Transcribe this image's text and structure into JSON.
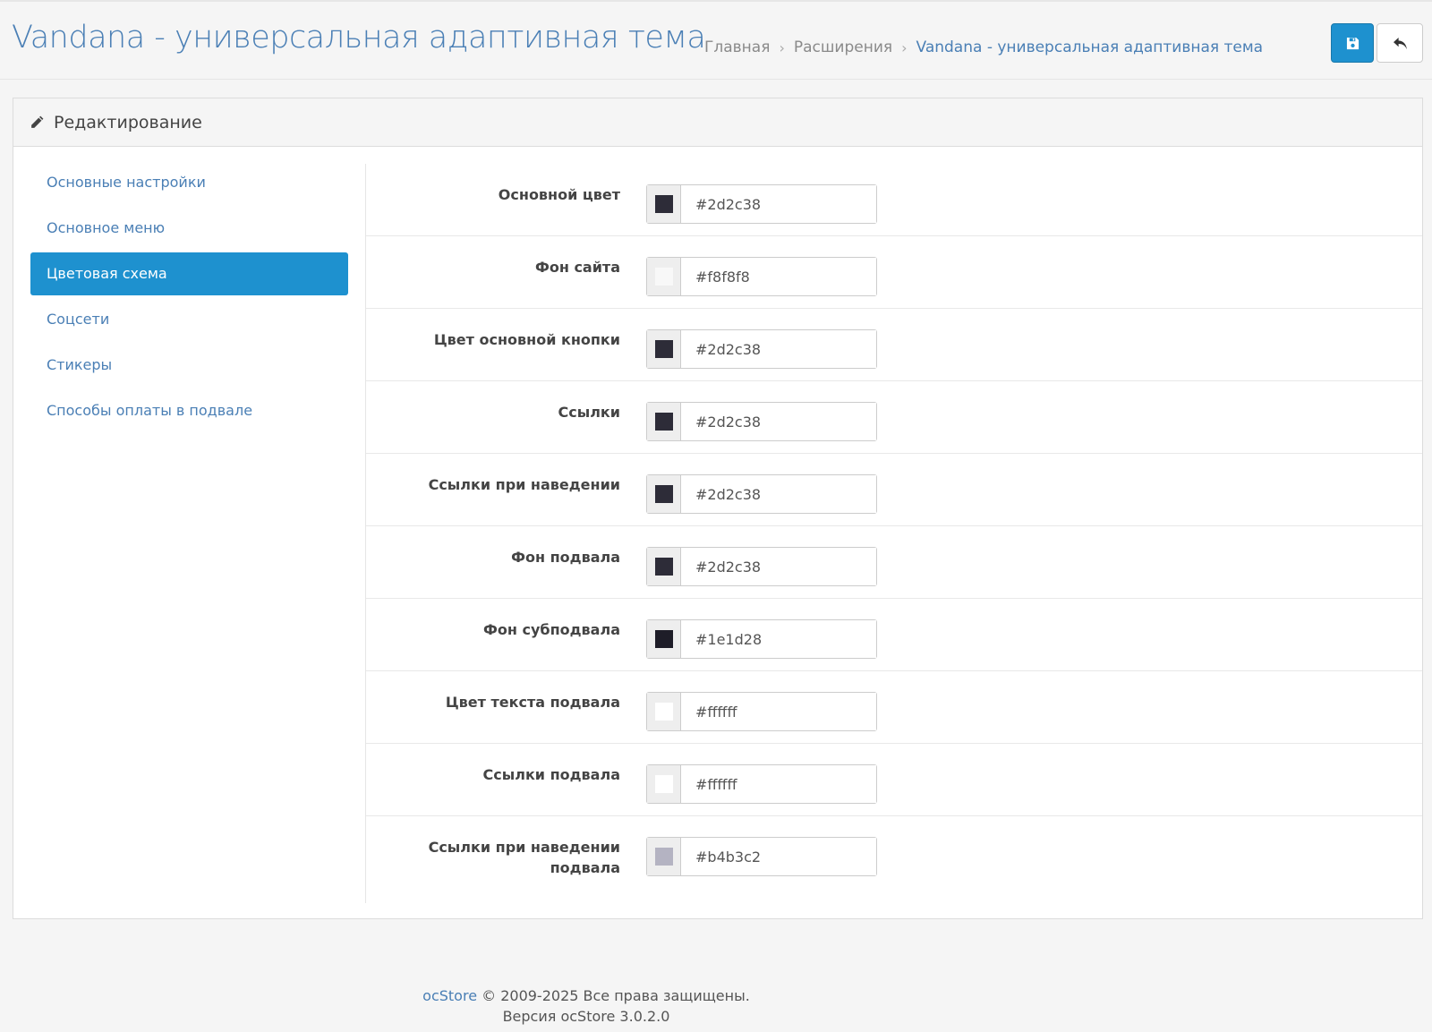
{
  "header": {
    "title": "Vandana - универсальная адаптивная тема",
    "breadcrumb": [
      "Главная",
      "Расширения",
      "Vandana - универсальная адаптивная тема"
    ],
    "save_icon": "floppy-disk-icon",
    "back_icon": "reply-icon"
  },
  "panel": {
    "icon": "pencil-icon",
    "title": "Редактирование"
  },
  "nav": {
    "items": [
      "Основные настройки",
      "Основное меню",
      "Цветовая схема",
      "Соцсети",
      "Стикеры",
      "Способы оплаты в подвале"
    ],
    "active_index": 2
  },
  "colors": [
    {
      "label": "Основной цвет",
      "value": "#2d2c38"
    },
    {
      "label": "Фон сайта",
      "value": "#f8f8f8"
    },
    {
      "label": "Цвет основной кнопки",
      "value": "#2d2c38"
    },
    {
      "label": "Ссылки",
      "value": "#2d2c38"
    },
    {
      "label": "Ссылки при наведении",
      "value": "#2d2c38"
    },
    {
      "label": "Фон подвала",
      "value": "#2d2c38"
    },
    {
      "label": "Фон субподвала",
      "value": "#1e1d28"
    },
    {
      "label": "Цвет текста подвала",
      "value": "#ffffff"
    },
    {
      "label": "Ссылки подвала",
      "value": "#ffffff"
    },
    {
      "label": "Ссылки при наведении подвала",
      "value": "#b4b3c2"
    }
  ],
  "footer": {
    "brand": "ocStore",
    "copyright": "© 2009-2025 Все права защищены.",
    "version": "Версия ocStore 3.0.2.0"
  },
  "theme": {
    "accent": "#1e91cf",
    "link": "#4a7fb5"
  }
}
